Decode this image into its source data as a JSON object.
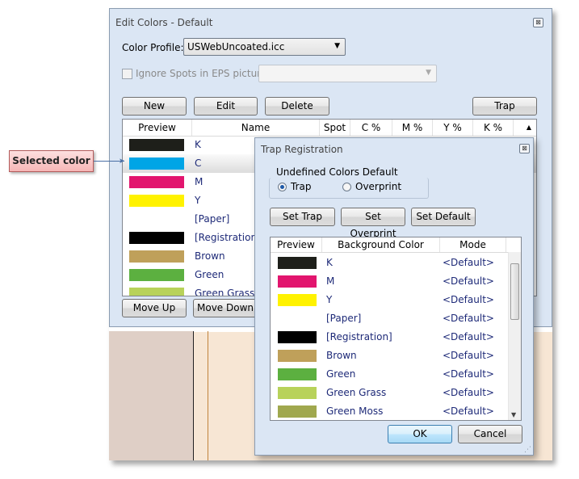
{
  "main_dialog": {
    "title": "Edit Colors - Default",
    "close_glyph": "⊠",
    "color_profile_label": "Color Profile:",
    "color_profile_value": "USWebUncoated.icc",
    "ignore_spots_label": "Ignore Spots in EPS pictures",
    "ignore_spots_value": "",
    "buttons": {
      "new": "New",
      "edit": "Edit",
      "delete": "Delete",
      "trap": "Trap",
      "move_up": "Move Up",
      "move_down": "Move Down"
    },
    "columns": [
      "Preview",
      "Name",
      "Spot",
      "C %",
      "M %",
      "Y %",
      "K %"
    ],
    "colors": [
      {
        "name": "K",
        "hex": "#1e1f1a",
        "selected": false
      },
      {
        "name": "C",
        "hex": "#00a5e6",
        "selected": true
      },
      {
        "name": "M",
        "hex": "#e2156e",
        "selected": false
      },
      {
        "name": "Y",
        "hex": "#fff200",
        "selected": false
      },
      {
        "name": "[Paper]",
        "hex": "",
        "selected": false
      },
      {
        "name": "[Registration]",
        "hex": "#000000",
        "selected": false
      },
      {
        "name": "Brown",
        "hex": "#bfa05a",
        "selected": false
      },
      {
        "name": "Green",
        "hex": "#5cb040",
        "selected": false
      },
      {
        "name": "Green Grass",
        "hex": "#b8d25a",
        "selected": false
      }
    ]
  },
  "trap_dialog": {
    "title": "Trap Registration",
    "close_glyph": "⊠",
    "group_label": "Undefined Colors Default",
    "radio_trap": "Trap",
    "radio_overprint": "Overprint",
    "selected_radio": "Trap",
    "buttons": {
      "set_trap": "Set Trap",
      "set_overprint": "Set Overprint",
      "set_default": "Set Default",
      "ok": "OK",
      "cancel": "Cancel"
    },
    "columns": [
      "Preview",
      "Background Color",
      "Mode"
    ],
    "rows": [
      {
        "name": "K",
        "mode": "<Default>",
        "hex": "#1e1f1a"
      },
      {
        "name": "M",
        "mode": "<Default>",
        "hex": "#e2156e"
      },
      {
        "name": "Y",
        "mode": "<Default>",
        "hex": "#fff200"
      },
      {
        "name": "[Paper]",
        "mode": "<Default>",
        "hex": ""
      },
      {
        "name": "[Registration]",
        "mode": "<Default>",
        "hex": "#000000"
      },
      {
        "name": "Brown",
        "mode": "<Default>",
        "hex": "#bfa05a"
      },
      {
        "name": "Green",
        "mode": "<Default>",
        "hex": "#5cb040"
      },
      {
        "name": "Green Grass",
        "mode": "<Default>",
        "hex": "#b8d25a"
      },
      {
        "name": "Green Moss",
        "mode": "<Default>",
        "hex": "#a0a84e"
      }
    ]
  },
  "callout": {
    "text": "Selected color"
  }
}
